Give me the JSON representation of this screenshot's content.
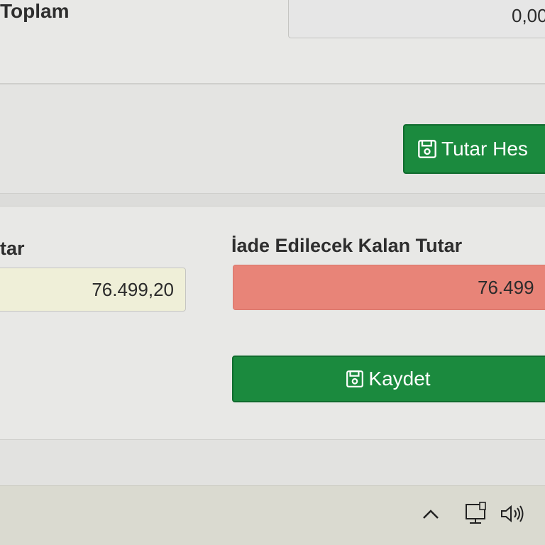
{
  "top_section": {
    "toplam_label": "Toplam",
    "toplam_value": "0,00"
  },
  "mid_section": {
    "calculate_button_label": "Tutar Hes"
  },
  "bottom_section": {
    "left_label": "tar",
    "left_value": "76.499,20",
    "refund_label": "İade Edilecek Kalan Tutar",
    "refund_value": "76.499",
    "save_button_label": "Kaydet"
  },
  "taskbar": {
    "icons": [
      "chevron-up-icon",
      "network-icon",
      "speaker-icon"
    ]
  },
  "colors": {
    "button_green": "#1b8a3e",
    "refund_field_red": "#e88478",
    "left_field_yellow": "#efefd8"
  }
}
